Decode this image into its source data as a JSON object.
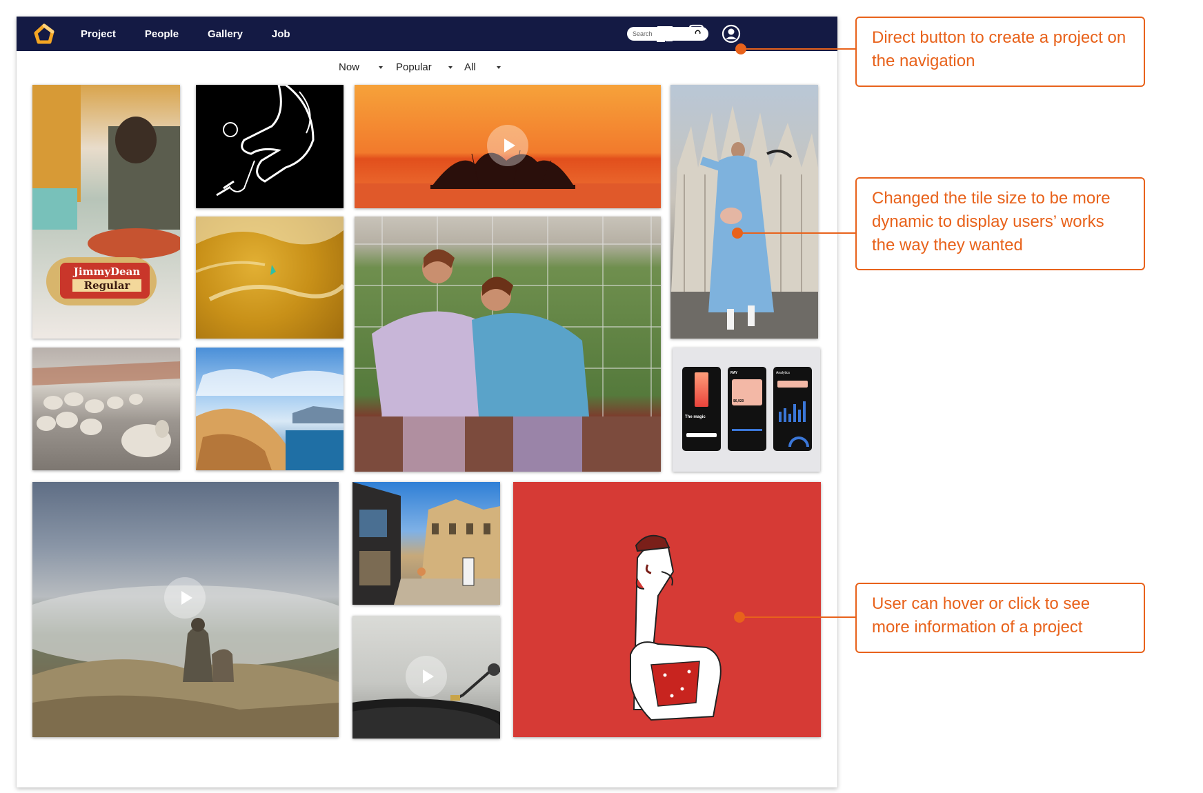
{
  "nav": {
    "links": [
      "Project",
      "People",
      "Gallery",
      "Job"
    ],
    "search_placeholder": "Search",
    "brand_color": "#141a44",
    "logo_color": "#f5a623"
  },
  "filters": [
    "Now",
    "Popular",
    "All"
  ],
  "tiles": [
    {
      "name": "tile-sausage-breakfast",
      "has_play": false,
      "label_lines": [
        "JimmyDean",
        "Regular"
      ]
    },
    {
      "name": "tile-ink-hand-illustration",
      "has_play": false
    },
    {
      "name": "tile-sunset-lake",
      "has_play": true
    },
    {
      "name": "tile-milan-cathedral-fashion",
      "has_play": false
    },
    {
      "name": "tile-golden-texture",
      "has_play": false
    },
    {
      "name": "tile-two-women-soccer-goal",
      "has_play": false
    },
    {
      "name": "tile-mobile-app-screens",
      "has_play": false,
      "screen_text": [
        "The magic",
        "RAY",
        "$6,920",
        "Analytics"
      ]
    },
    {
      "name": "tile-sheep-herd",
      "has_play": false
    },
    {
      "name": "tile-coastal-rocks",
      "has_play": false
    },
    {
      "name": "tile-misty-cliff-dog",
      "has_play": true
    },
    {
      "name": "tile-old-town-street",
      "has_play": false
    },
    {
      "name": "tile-turntable",
      "has_play": true
    },
    {
      "name": "tile-red-finger-character",
      "has_play": false
    }
  ],
  "annotations": [
    {
      "text": "Direct button to create a project on the navigation"
    },
    {
      "text": "Changed the tile size to be more dynamic to display users’ works the way they wanted"
    },
    {
      "text": "User can hover or click to see more information of a project"
    }
  ],
  "accent_color": "#e8621b"
}
